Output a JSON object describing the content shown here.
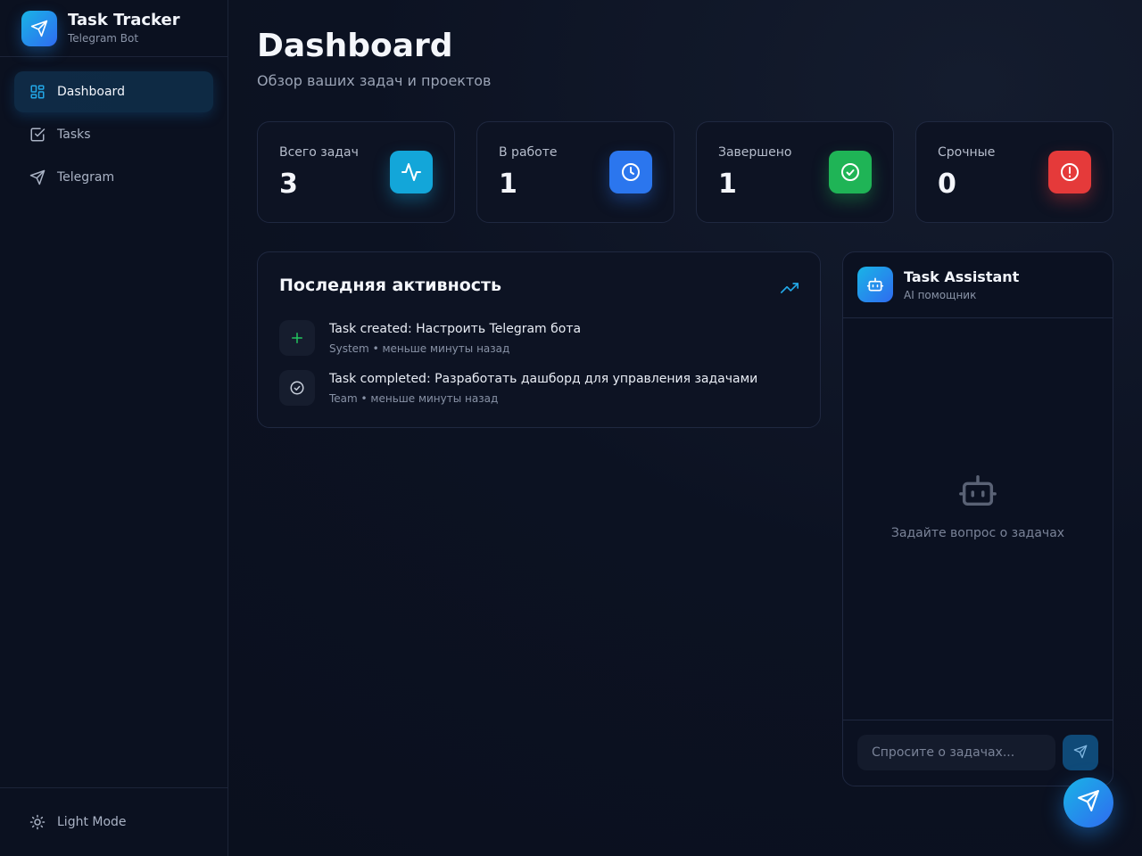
{
  "brand": {
    "title": "Task Tracker",
    "subtitle": "Telegram Bot"
  },
  "sidebar": {
    "items": [
      {
        "label": "Dashboard",
        "icon": "layout-grid-icon",
        "active": true
      },
      {
        "label": "Tasks",
        "icon": "checkbox-icon",
        "active": false
      },
      {
        "label": "Telegram",
        "icon": "send-icon",
        "active": false
      }
    ],
    "theme_toggle": {
      "label": "Light Mode",
      "icon": "sun-icon"
    }
  },
  "header": {
    "title": "Dashboard",
    "subtitle": "Обзор ваших задач и проектов"
  },
  "stats": [
    {
      "label": "Всего задач",
      "value": "3",
      "icon": "activity-icon",
      "color": "#13a6d9"
    },
    {
      "label": "В работе",
      "value": "1",
      "icon": "clock-icon",
      "color": "#2b76ee"
    },
    {
      "label": "Завершено",
      "value": "1",
      "icon": "check-circle-icon",
      "color": "#1fb456"
    },
    {
      "label": "Срочные",
      "value": "0",
      "icon": "alert-circle-icon",
      "color": "#e53a3a"
    }
  ],
  "activity": {
    "title": "Последняя активность",
    "items": [
      {
        "text": "Task created: Настроить Telegram бота",
        "meta": "System • меньше минуты назад",
        "icon": "plus-icon"
      },
      {
        "text": "Task completed: Разработать дашборд для управления задачами",
        "meta": "Team • меньше минуты назад",
        "icon": "check-circle-icon"
      }
    ]
  },
  "assistant": {
    "title": "Task Assistant",
    "subtitle": "AI помощник",
    "empty_text": "Задайте вопрос о задачах",
    "input_placeholder": "Спросите о задачах..."
  },
  "colors": {
    "accent": "#19b4e6",
    "accent_dark": "#2f6bf0",
    "background": "#0c1222"
  }
}
